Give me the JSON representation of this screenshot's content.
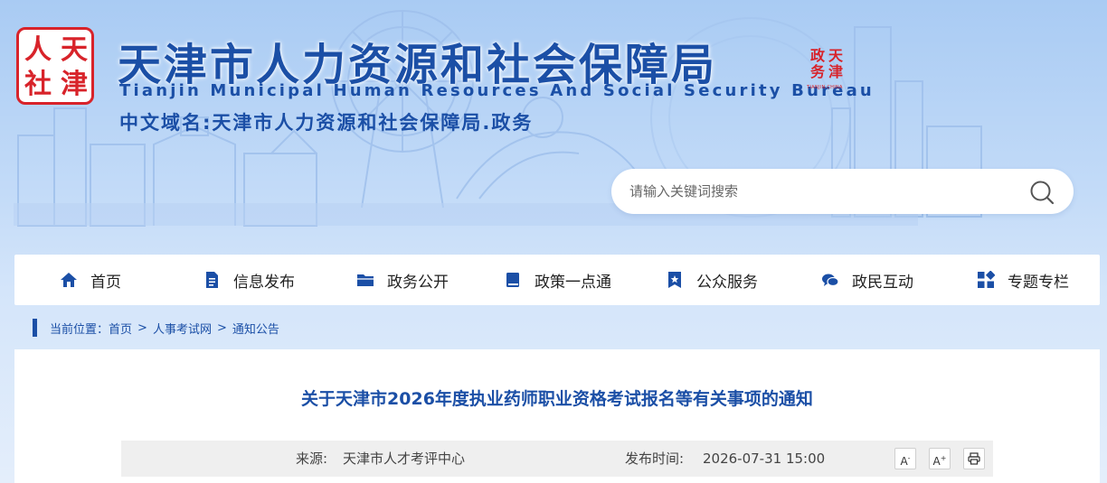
{
  "header": {
    "logo_chars": [
      "天",
      "人",
      "津",
      "社"
    ],
    "title_cn": "天津市人力资源和社会保障局",
    "title_en": "Tianjin Municipal Human Resources And Social Security Bureau",
    "domain_line": "中文域名:天津市人力资源和社会保障局.政务",
    "gov_badge_chars": [
      "天",
      "政",
      "津",
      "务"
    ],
    "gov_badge_sub": "TIANJIN.CHINA"
  },
  "search": {
    "placeholder": "请输入关键词搜索"
  },
  "nav": {
    "items": [
      {
        "label": "首页",
        "icon": "home-icon"
      },
      {
        "label": "信息发布",
        "icon": "document-icon"
      },
      {
        "label": "政务公开",
        "icon": "folder-icon"
      },
      {
        "label": "政策一点通",
        "icon": "book-icon"
      },
      {
        "label": "公众服务",
        "icon": "bookmark-star-icon"
      },
      {
        "label": "政民互动",
        "icon": "chat-icon"
      },
      {
        "label": "专题专栏",
        "icon": "grid-icon"
      }
    ]
  },
  "breadcrumb": {
    "prefix": "当前位置：",
    "items": [
      "首页",
      "人事考试网",
      "通知公告"
    ],
    "separator": ">"
  },
  "article": {
    "title": "关于天津市2026年度执业药师职业资格考试报名等有关事项的通知",
    "source_label": "来源:",
    "source_value": "天津市人才考评中心",
    "time_label": "发布时间:",
    "time_value": "2026-07-31 15:00",
    "font_decrease": "A",
    "font_decrease_sup": "-",
    "font_increase": "A",
    "font_increase_sup": "+"
  },
  "colors": {
    "primary": "#1b4fa6",
    "seal_red": "#d8232a",
    "meta_bg": "#efefef"
  }
}
